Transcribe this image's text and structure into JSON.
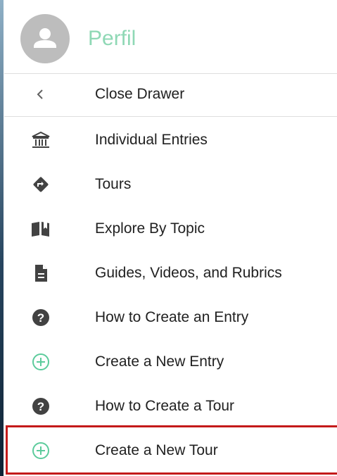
{
  "profile": {
    "name": "Perfil",
    "accent_color": "#8fd8b5"
  },
  "menu": {
    "items": [
      {
        "label": "Close Drawer",
        "icon": "chevron-left-icon"
      },
      {
        "label": "Individual Entries",
        "icon": "institution-icon"
      },
      {
        "label": "Tours",
        "icon": "directions-icon"
      },
      {
        "label": "Explore By Topic",
        "icon": "book-open-icon"
      },
      {
        "label": "Guides, Videos, and Rubrics",
        "icon": "document-icon"
      },
      {
        "label": "How to Create an Entry",
        "icon": "help-circle-icon"
      },
      {
        "label": "Create a New Entry",
        "icon": "plus-circle-icon",
        "icon_color": "#5ccb9c"
      },
      {
        "label": "How to Create a Tour",
        "icon": "help-circle-icon"
      },
      {
        "label": "Create a New Tour",
        "icon": "plus-circle-icon",
        "icon_color": "#5ccb9c",
        "highlighted": true
      }
    ]
  },
  "colors": {
    "highlight": "#c41a1a",
    "icon": "#424242",
    "text": "#212121"
  }
}
